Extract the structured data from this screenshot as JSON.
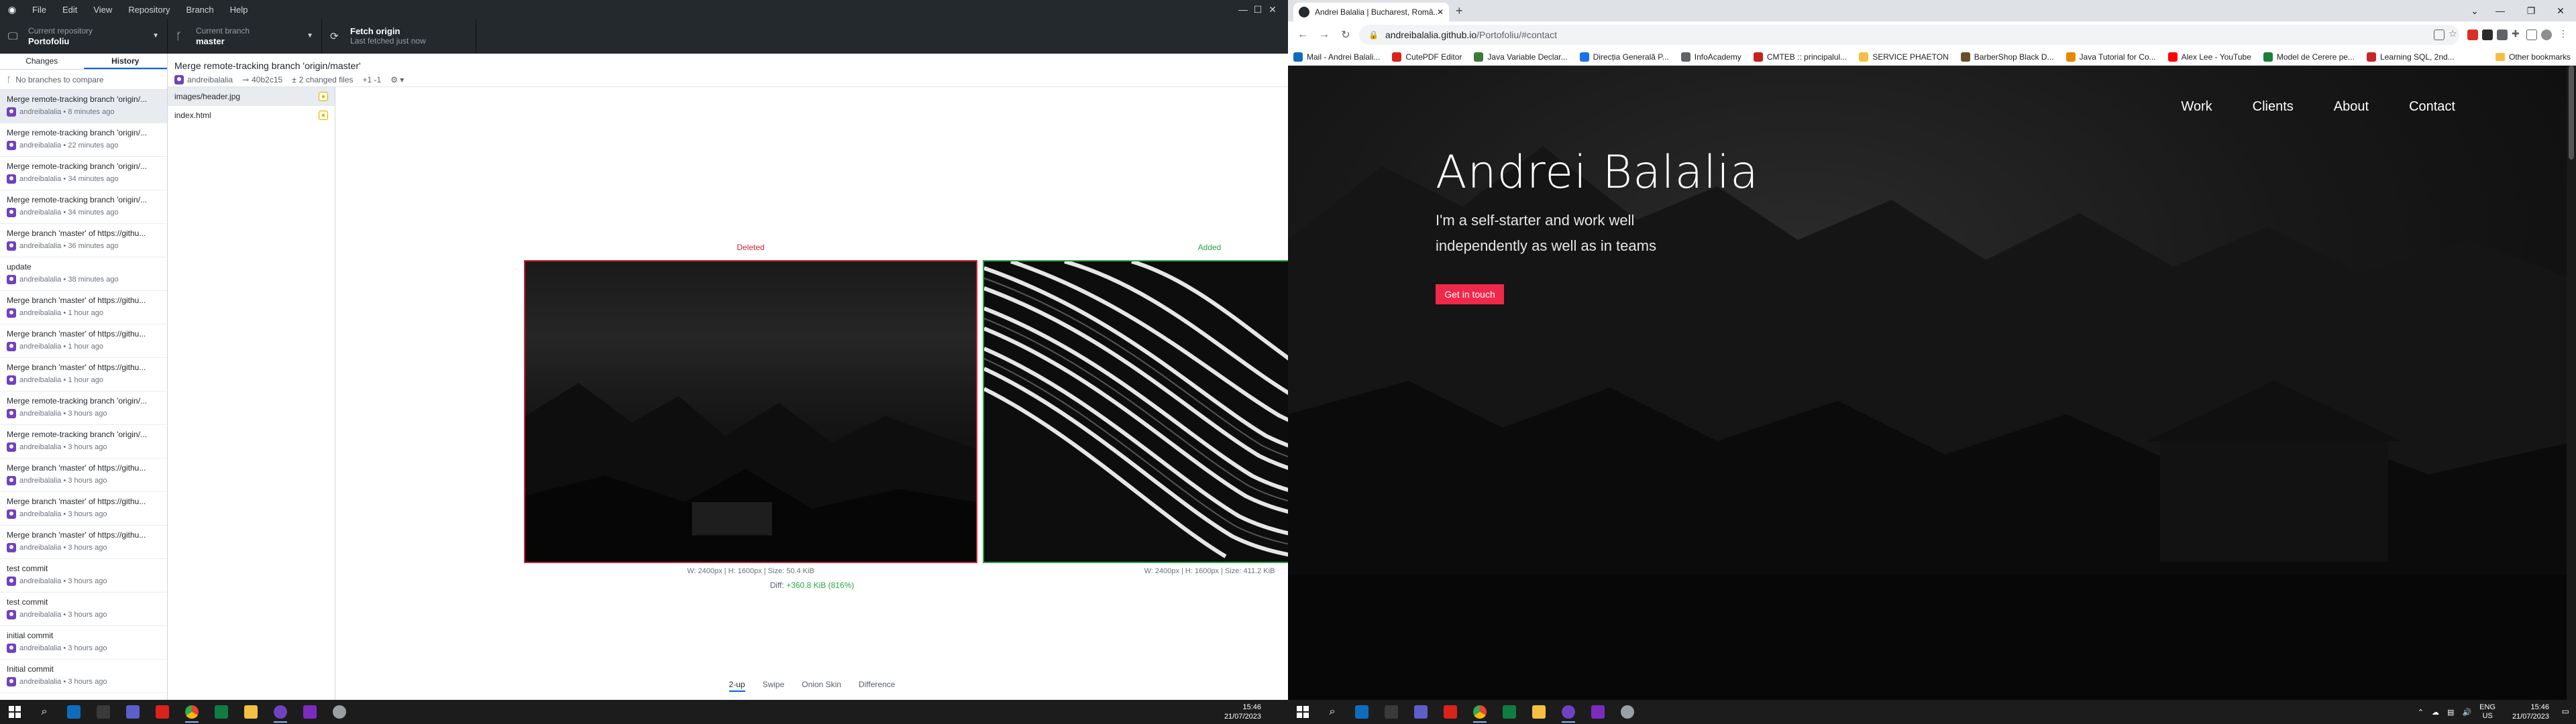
{
  "left": {
    "menu": [
      "File",
      "Edit",
      "View",
      "Repository",
      "Branch",
      "Help"
    ],
    "toolbar": {
      "repo_label": "Current repository",
      "repo_value": "Portofoliu",
      "branch_label": "Current branch",
      "branch_value": "master",
      "fetch_label": "Fetch origin",
      "fetch_sub": "Last fetched just now"
    },
    "sidebar": {
      "tabs": [
        "Changes",
        "History"
      ],
      "compare": "No branches to compare",
      "commits": [
        {
          "msg": "Merge remote-tracking branch 'origin/...",
          "meta": "andreibalalia • 8 minutes ago"
        },
        {
          "msg": "Merge remote-tracking branch 'origin/...",
          "meta": "andreibalalia • 22 minutes ago"
        },
        {
          "msg": "Merge remote-tracking branch 'origin/...",
          "meta": "andreibalalia • 34 minutes ago"
        },
        {
          "msg": "Merge remote-tracking branch 'origin/...",
          "meta": "andreibalalia • 34 minutes ago"
        },
        {
          "msg": "Merge branch 'master' of https://githu...",
          "meta": "andreibalalia • 36 minutes ago"
        },
        {
          "msg": "update",
          "meta": "andreibalalia • 38 minutes ago"
        },
        {
          "msg": "Merge branch 'master' of https://githu...",
          "meta": "andreibalalia • 1 hour ago"
        },
        {
          "msg": "Merge branch 'master' of https://githu...",
          "meta": "andreibalalia • 1 hour ago"
        },
        {
          "msg": "Merge branch 'master' of https://githu...",
          "meta": "andreibalalia • 1 hour ago"
        },
        {
          "msg": "Merge remote-tracking branch 'origin/...",
          "meta": "andreibalalia • 3 hours ago"
        },
        {
          "msg": "Merge remote-tracking branch 'origin/...",
          "meta": "andreibalalia • 3 hours ago"
        },
        {
          "msg": "Merge branch 'master' of https://githu...",
          "meta": "andreibalalia • 3 hours ago"
        },
        {
          "msg": "Merge branch 'master' of https://githu...",
          "meta": "andreibalalia • 3 hours ago"
        },
        {
          "msg": "Merge branch 'master' of https://githu...",
          "meta": "andreibalalia • 3 hours ago"
        },
        {
          "msg": "test commit",
          "meta": "andreibalalia • 3 hours ago"
        },
        {
          "msg": "test commit",
          "meta": "andreibalalia • 3 hours ago"
        },
        {
          "msg": "initial commit",
          "meta": "andreibalalia • 3 hours ago"
        },
        {
          "msg": "Initial commit",
          "meta": "andreibalalia • 3 hours ago"
        }
      ]
    },
    "commit": {
      "title": "Merge remote-tracking branch 'origin/master'",
      "author": "andreibalalia",
      "sha": "40b2c15",
      "files_changed": "2 changed files",
      "counts": "+1 -1",
      "files": [
        "images/header.jpg",
        "index.html"
      ]
    },
    "diff": {
      "deleted_label": "Deleted",
      "added_label": "Added",
      "deleted_dims": "W: 2400px | H: 1600px | Size: 50.4 KiB",
      "added_dims": "W: 2400px | H: 1600px | Size: 411.2 KiB",
      "diff_prefix": "Diff:",
      "diff_value": "+360.8 KiB (816%)",
      "modes": [
        "2-up",
        "Swipe",
        "Onion Skin",
        "Difference"
      ]
    },
    "taskbar": {
      "time": "15:46",
      "date": "21/07/2023"
    }
  },
  "right": {
    "tab_title": "Andrei Balalia | Bucharest, Româ...",
    "url_host": "andreibalalia.github.io",
    "url_path": "/Portofoliu/#contact",
    "bookmarks": [
      "Mail - Andrei Balali...",
      "CutePDF Editor",
      "Java Variable Declar...",
      "Direcția Generală P...",
      "InfoAcademy",
      "CMTEB :: principalul...",
      "SERVICE PHAETON",
      "BarberShop Black D...",
      "Java Tutorial for Co...",
      "Alex Lee - YouTube",
      "Model de Cerere pe...",
      "Learning SQL, 2nd..."
    ],
    "other_bookmarks": "Other bookmarks",
    "nav": [
      "Work",
      "Clients",
      "About",
      "Contact"
    ],
    "hero_name": "Andrei Balalia",
    "hero_tag": "I'm a self-starter and work well independently as well as in teams",
    "cta": "Get in touch",
    "taskbar": {
      "lang": "ENG",
      "region": "US",
      "time": "15:46",
      "date": "21/07/2023"
    }
  }
}
